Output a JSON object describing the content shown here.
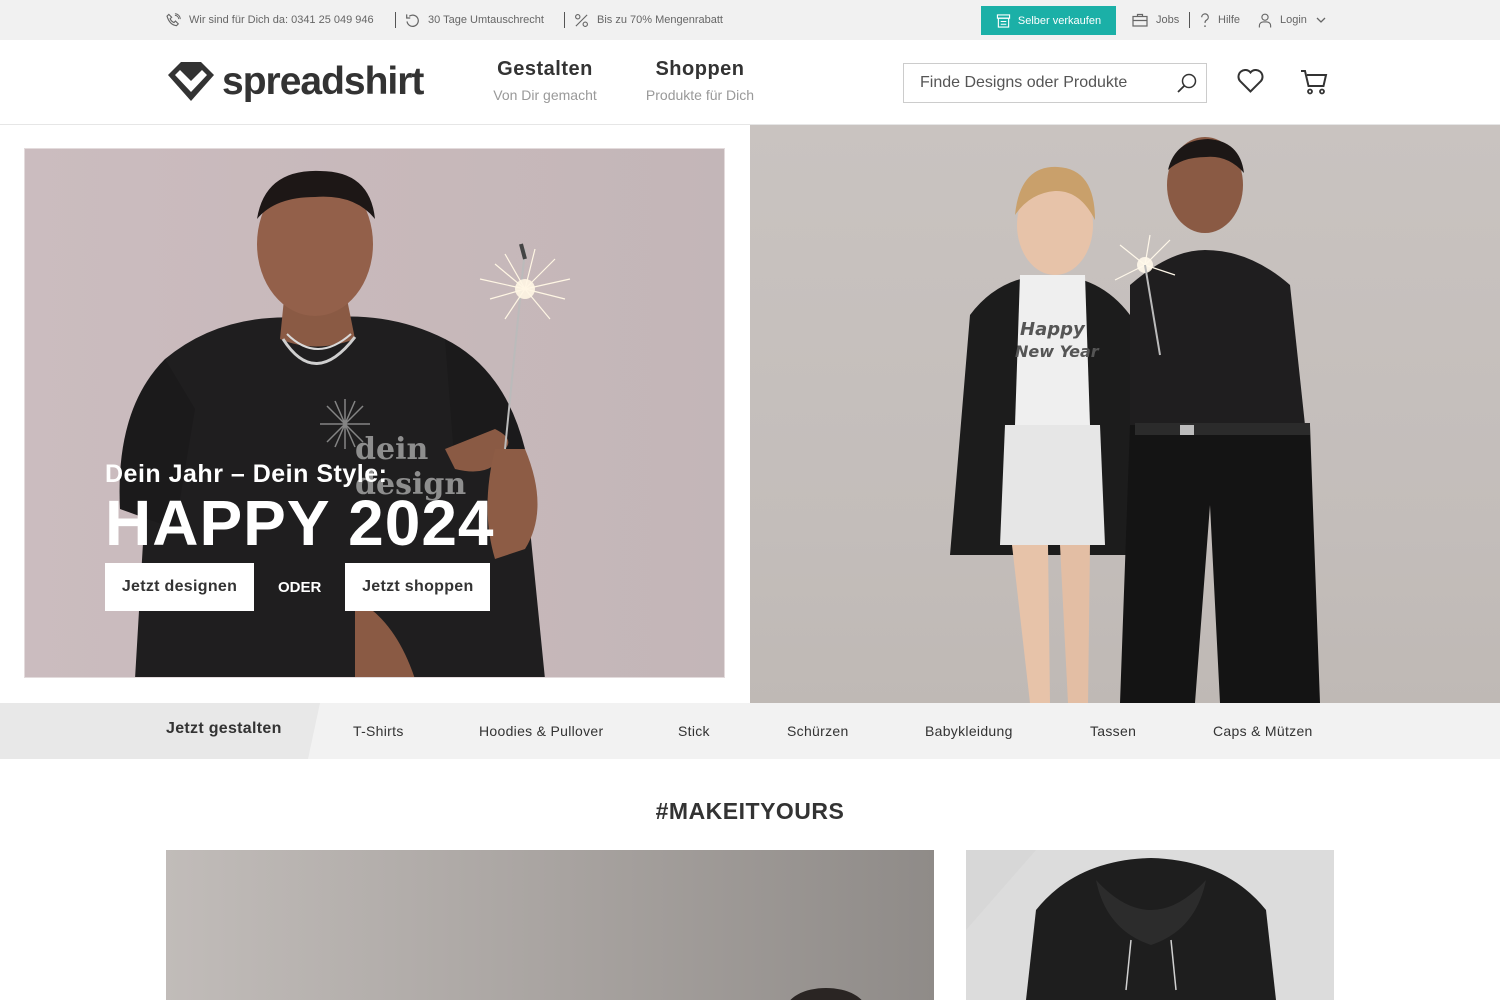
{
  "topbar": {
    "phone_text": "Wir sind für Dich da: 0341 25 049 946",
    "exchange_text": "30 Tage Umtauschrecht",
    "discount_text": "Bis zu 70% Mengenrabatt",
    "sell_label": "Selber verkaufen",
    "jobs_label": "Jobs",
    "help_label": "Hilfe",
    "login_label": "Login"
  },
  "header": {
    "logo_text": "spreadshirt",
    "nav": [
      {
        "title": "Gestalten",
        "subtitle": "Von Dir gemacht"
      },
      {
        "title": "Shoppen",
        "subtitle": "Produkte für Dich"
      }
    ],
    "search_placeholder": "Finde Designs oder Produkte"
  },
  "hero": {
    "subtitle": "Dein Jahr – Dein Style:",
    "title": "HAPPY 2024",
    "design_button": "Jetzt designen",
    "or_text": "ODER",
    "shop_button": "Jetzt shoppen"
  },
  "categories": {
    "start_label": "Jetzt gestalten",
    "items": [
      "T-Shirts",
      "Hoodies & Pullover",
      "Stick",
      "Schürzen",
      "Babykleidung",
      "Tassen",
      "Caps & Mützen"
    ]
  },
  "section": {
    "hashtag": "#MAKEITYOURS"
  },
  "colors": {
    "accent": "#1bb0a7",
    "text": "#333333",
    "muted": "#999999"
  }
}
